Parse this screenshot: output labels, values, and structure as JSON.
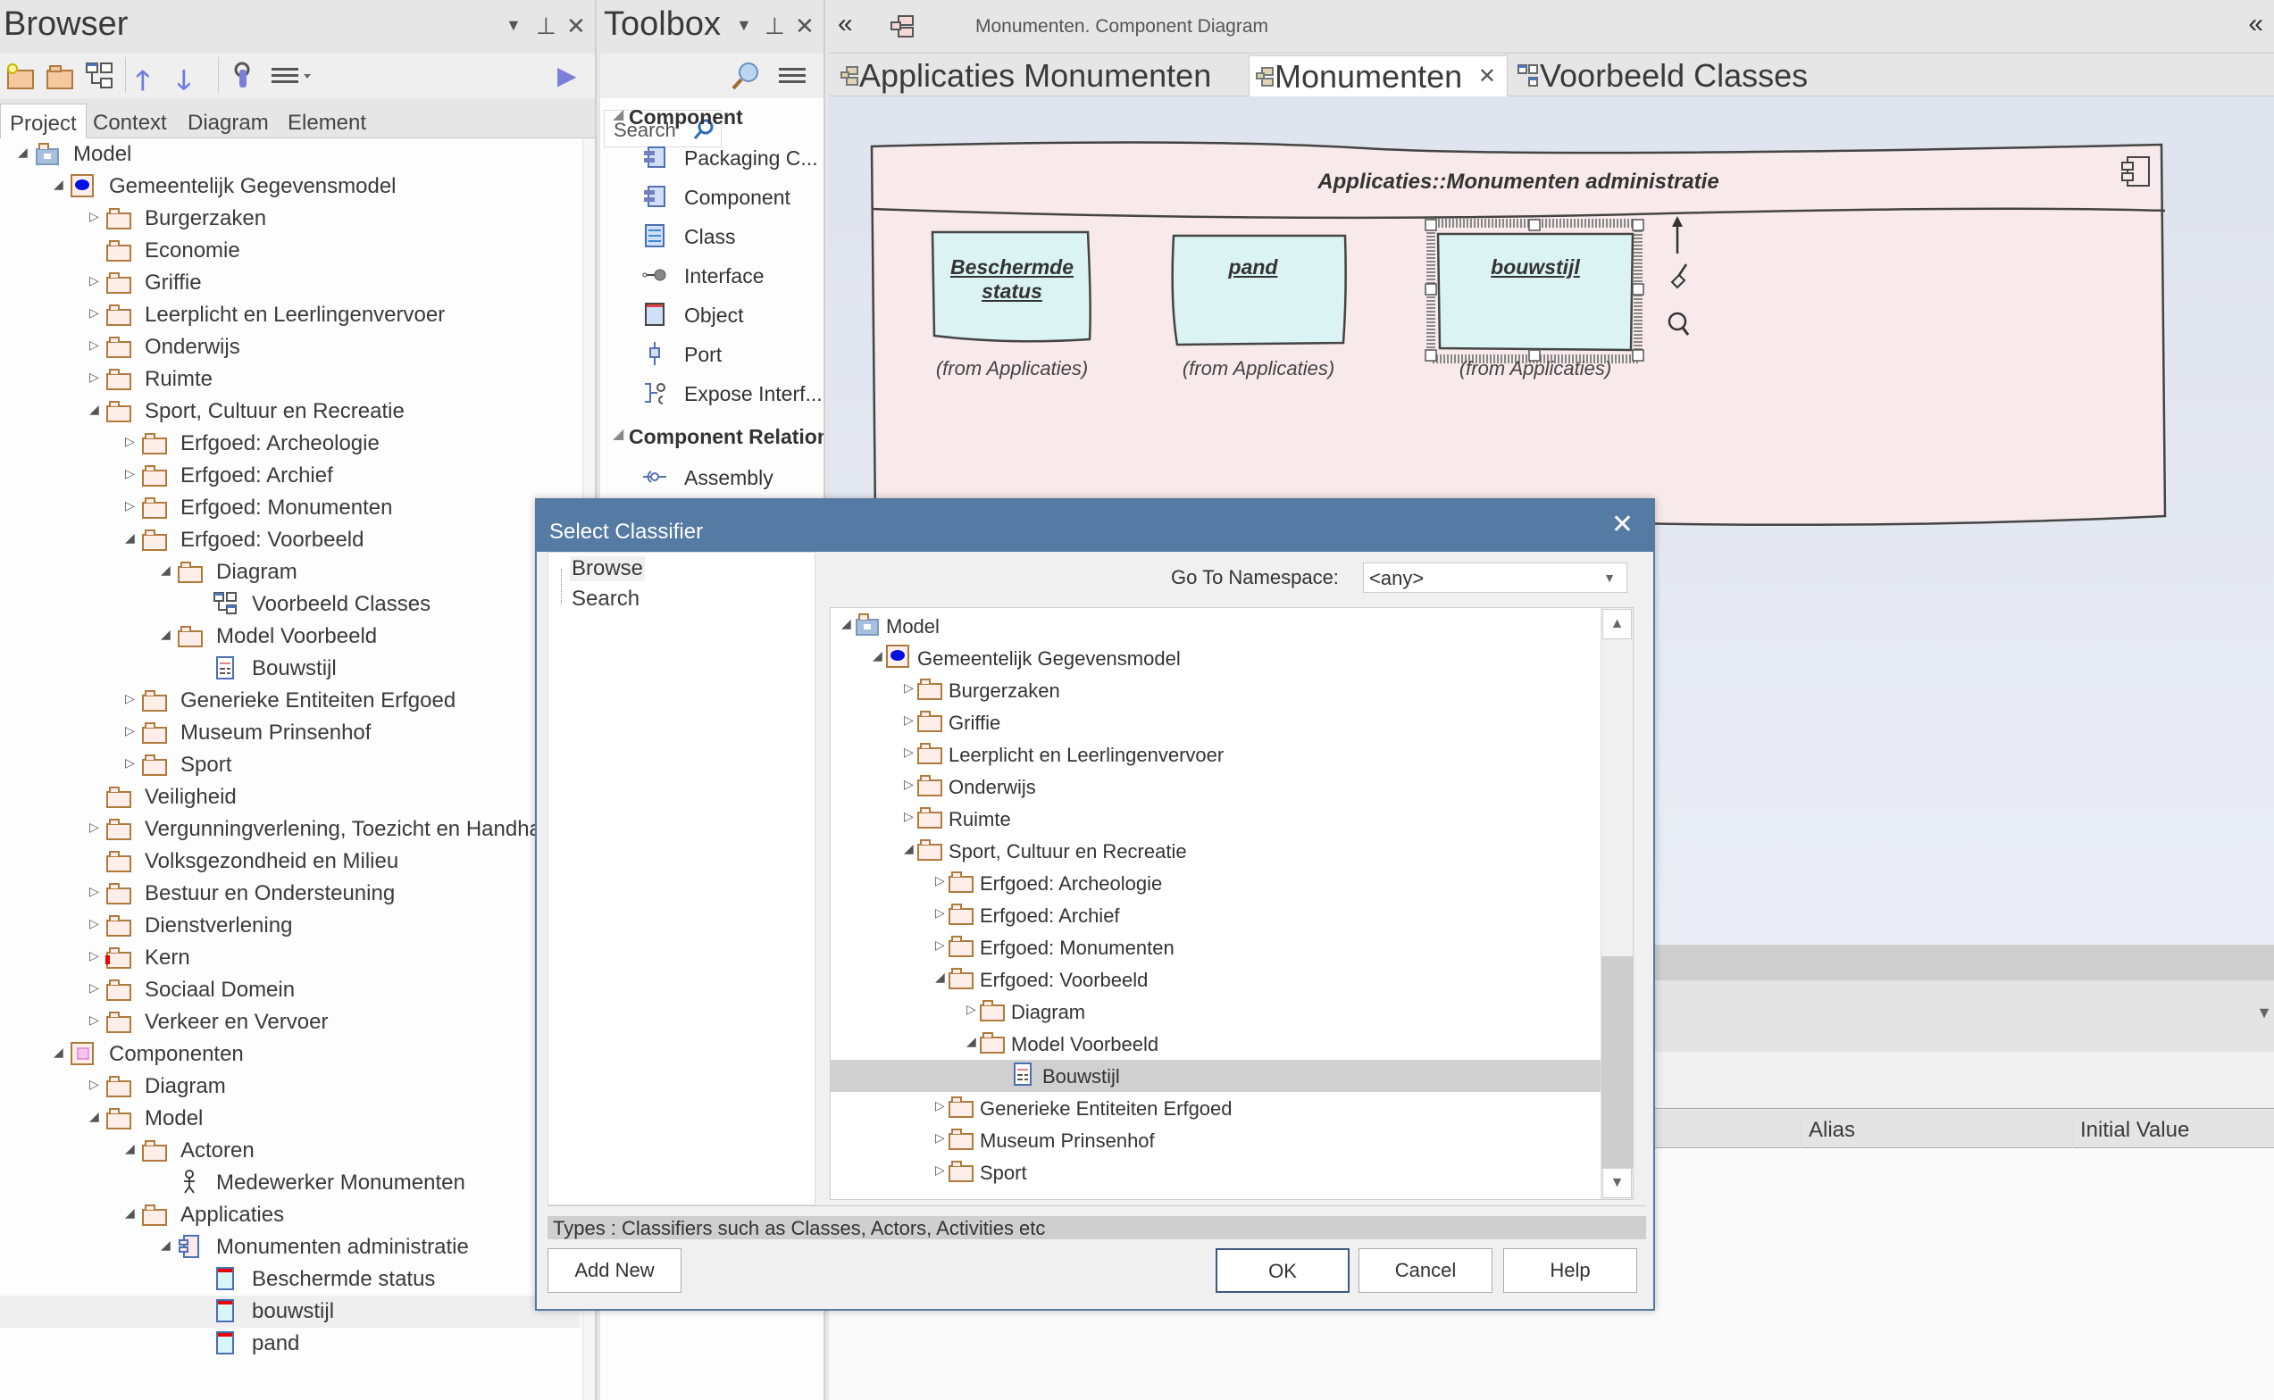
{
  "browser": {
    "title": "Browser",
    "tabs": [
      "Project",
      "Context",
      "Diagram",
      "Element"
    ],
    "active_tab": "Project",
    "tree": [
      {
        "label": "Model",
        "depth": 0,
        "expander": "open",
        "icon": "model-root"
      },
      {
        "label": "Gemeentelijk Gegevensmodel",
        "depth": 1,
        "expander": "open",
        "icon": "model-package"
      },
      {
        "label": "Burgerzaken",
        "depth": 2,
        "expander": "closed",
        "icon": "folder"
      },
      {
        "label": "Economie",
        "depth": 2,
        "expander": "none",
        "icon": "folder"
      },
      {
        "label": "Griffie",
        "depth": 2,
        "expander": "closed",
        "icon": "folder"
      },
      {
        "label": "Leerplicht en Leerlingenvervoer",
        "depth": 2,
        "expander": "closed",
        "icon": "folder"
      },
      {
        "label": "Onderwijs",
        "depth": 2,
        "expander": "closed",
        "icon": "folder"
      },
      {
        "label": "Ruimte",
        "depth": 2,
        "expander": "closed",
        "icon": "folder"
      },
      {
        "label": "Sport, Cultuur en Recreatie",
        "depth": 2,
        "expander": "open",
        "icon": "folder"
      },
      {
        "label": "Erfgoed: Archeologie",
        "depth": 3,
        "expander": "closed",
        "icon": "folder"
      },
      {
        "label": "Erfgoed: Archief",
        "depth": 3,
        "expander": "closed",
        "icon": "folder"
      },
      {
        "label": "Erfgoed: Monumenten",
        "depth": 3,
        "expander": "closed",
        "icon": "folder"
      },
      {
        "label": "Erfgoed: Voorbeeld",
        "depth": 3,
        "expander": "open",
        "icon": "folder"
      },
      {
        "label": "Diagram",
        "depth": 4,
        "expander": "open",
        "icon": "folder"
      },
      {
        "label": "Voorbeeld Classes",
        "depth": 5,
        "expander": "none",
        "icon": "class-diagram"
      },
      {
        "label": "Model Voorbeeld",
        "depth": 4,
        "expander": "open",
        "icon": "folder"
      },
      {
        "label": "Bouwstijl",
        "depth": 5,
        "expander": "none",
        "icon": "enumeration"
      },
      {
        "label": "Generieke Entiteiten Erfgoed",
        "depth": 3,
        "expander": "closed",
        "icon": "folder"
      },
      {
        "label": "Museum Prinsenhof",
        "depth": 3,
        "expander": "closed",
        "icon": "folder"
      },
      {
        "label": "Sport",
        "depth": 3,
        "expander": "closed",
        "icon": "folder"
      },
      {
        "label": "Veiligheid",
        "depth": 2,
        "expander": "none",
        "icon": "folder"
      },
      {
        "label": "Vergunningverlening, Toezicht en Handhaving",
        "depth": 2,
        "expander": "closed",
        "icon": "folder"
      },
      {
        "label": "Volksgezondheid en Milieu",
        "depth": 2,
        "expander": "none",
        "icon": "folder"
      },
      {
        "label": "Bestuur en Ondersteuning",
        "depth": 2,
        "expander": "closed",
        "icon": "folder"
      },
      {
        "label": "Dienstverlening",
        "depth": 2,
        "expander": "closed",
        "icon": "folder"
      },
      {
        "label": "Kern",
        "depth": 2,
        "expander": "closed",
        "icon": "folder-locked"
      },
      {
        "label": "Sociaal Domein",
        "depth": 2,
        "expander": "closed",
        "icon": "folder"
      },
      {
        "label": "Verkeer en Vervoer",
        "depth": 2,
        "expander": "closed",
        "icon": "folder"
      },
      {
        "label": "Componenten",
        "depth": 1,
        "expander": "open",
        "icon": "component-package"
      },
      {
        "label": "Diagram",
        "depth": 2,
        "expander": "closed",
        "icon": "folder"
      },
      {
        "label": "Model",
        "depth": 2,
        "expander": "open",
        "icon": "folder"
      },
      {
        "label": "Actoren",
        "depth": 3,
        "expander": "open",
        "icon": "folder"
      },
      {
        "label": "Medewerker Monumenten",
        "depth": 4,
        "expander": "none",
        "icon": "actor"
      },
      {
        "label": "Applicaties",
        "depth": 3,
        "expander": "open",
        "icon": "folder"
      },
      {
        "label": "Monumenten administratie",
        "depth": 4,
        "expander": "open",
        "icon": "component"
      },
      {
        "label": "Beschermde status",
        "depth": 5,
        "expander": "none",
        "icon": "object"
      },
      {
        "label": "bouwstijl",
        "depth": 5,
        "expander": "none",
        "icon": "object",
        "selected": true
      },
      {
        "label": "pand",
        "depth": 5,
        "expander": "none",
        "icon": "object"
      }
    ]
  },
  "toolbox": {
    "title": "Toolbox",
    "search_placeholder": "Search",
    "sections": [
      {
        "label": "Component",
        "items": [
          "Packaging C...",
          "Component",
          "Class",
          "Interface",
          "Object",
          "Port",
          "Expose Interf..."
        ]
      },
      {
        "label": "Component Relation",
        "items": [
          "Assembly"
        ]
      }
    ]
  },
  "diagram": {
    "breadcrumb": "Monumenten.  Component Diagram",
    "tabs": [
      {
        "label": "Applicaties Monumenten",
        "active": false
      },
      {
        "label": "Monumenten",
        "active": true,
        "closable": true
      },
      {
        "label": "Voorbeeld Classes",
        "active": false
      }
    ],
    "close_tab_glyph": "✕",
    "component_title": "Applicaties::Monumenten administratie",
    "objects": [
      {
        "name": "Beschermde status",
        "from": "(from Applicaties)"
      },
      {
        "name": "pand",
        "from": "(from Applicaties)"
      },
      {
        "name": "bouwstijl",
        "from": "(from Applicaties)",
        "selected": true
      }
    ],
    "columns": [
      "Alias",
      "Initial Value"
    ]
  },
  "dialog": {
    "title": "Select Classifier",
    "close_glyph": "✕",
    "nav": [
      "Browse",
      "Search"
    ],
    "namespace_label": "Go To Namespace:",
    "namespace_value": "<any>",
    "tree": [
      {
        "label": "Model",
        "depth": 0,
        "expander": "open",
        "icon": "model-root"
      },
      {
        "label": "Gemeentelijk Gegevensmodel",
        "depth": 1,
        "expander": "open",
        "icon": "model-package"
      },
      {
        "label": "Burgerzaken",
        "depth": 2,
        "expander": "closed",
        "icon": "folder"
      },
      {
        "label": "Griffie",
        "depth": 2,
        "expander": "closed",
        "icon": "folder"
      },
      {
        "label": "Leerplicht en Leerlingenvervoer",
        "depth": 2,
        "expander": "closed",
        "icon": "folder"
      },
      {
        "label": "Onderwijs",
        "depth": 2,
        "expander": "closed",
        "icon": "folder"
      },
      {
        "label": "Ruimte",
        "depth": 2,
        "expander": "closed",
        "icon": "folder"
      },
      {
        "label": "Sport, Cultuur en Recreatie",
        "depth": 2,
        "expander": "open",
        "icon": "folder"
      },
      {
        "label": "Erfgoed: Archeologie",
        "depth": 3,
        "expander": "closed",
        "icon": "folder"
      },
      {
        "label": "Erfgoed: Archief",
        "depth": 3,
        "expander": "closed",
        "icon": "folder"
      },
      {
        "label": "Erfgoed: Monumenten",
        "depth": 3,
        "expander": "closed",
        "icon": "folder"
      },
      {
        "label": "Erfgoed: Voorbeeld",
        "depth": 3,
        "expander": "open",
        "icon": "folder"
      },
      {
        "label": "Diagram",
        "depth": 4,
        "expander": "closed",
        "icon": "folder"
      },
      {
        "label": "Model Voorbeeld",
        "depth": 4,
        "expander": "open",
        "icon": "folder"
      },
      {
        "label": "Bouwstijl",
        "depth": 5,
        "expander": "none",
        "icon": "enumeration",
        "selected": true
      },
      {
        "label": "Generieke Entiteiten Erfgoed",
        "depth": 3,
        "expander": "closed",
        "icon": "folder"
      },
      {
        "label": "Museum Prinsenhof",
        "depth": 3,
        "expander": "closed",
        "icon": "folder"
      },
      {
        "label": "Sport",
        "depth": 3,
        "expander": "closed",
        "icon": "folder"
      }
    ],
    "types_hint": "Types : Classifiers such as Classes, Actors, Activities etc",
    "buttons": {
      "add_new": "Add New",
      "ok": "OK",
      "cancel": "Cancel",
      "help": "Help"
    }
  }
}
